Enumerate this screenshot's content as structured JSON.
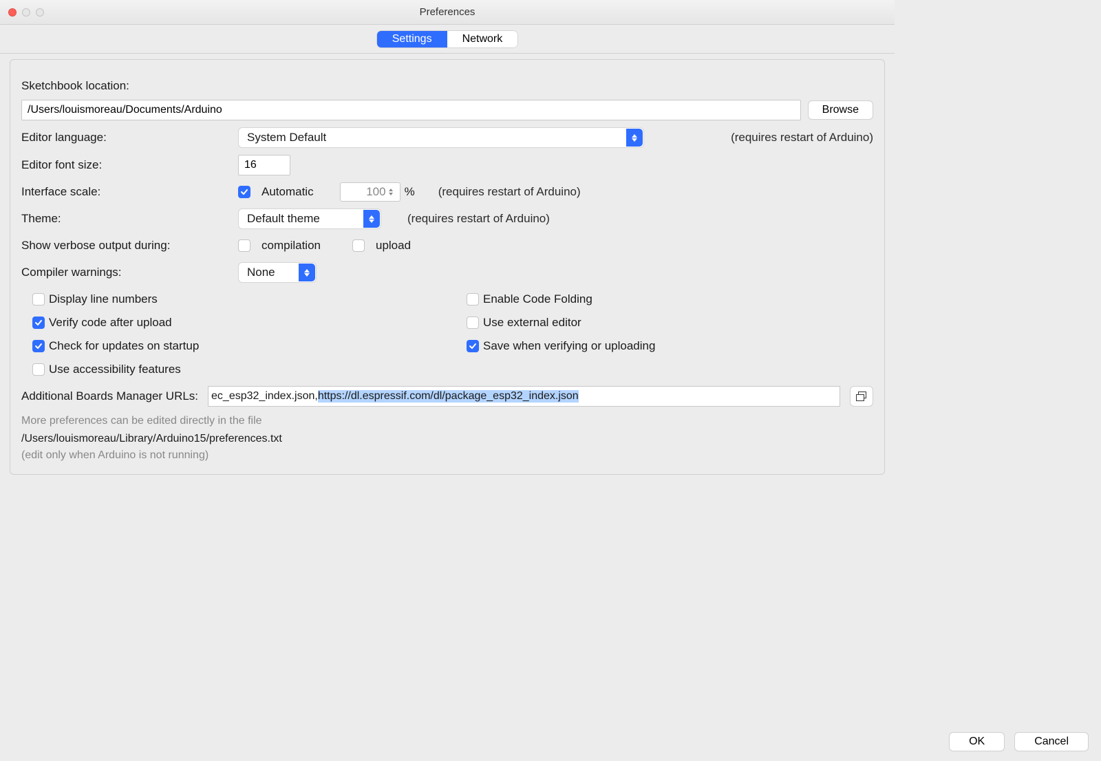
{
  "window": {
    "title": "Preferences"
  },
  "tabs": {
    "settings": "Settings",
    "network": "Network"
  },
  "sketchbook": {
    "label": "Sketchbook location:",
    "path": "/Users/louismoreau/Documents/Arduino",
    "browse": "Browse"
  },
  "editor_language": {
    "label": "Editor language:",
    "value": "System Default",
    "hint": "(requires restart of Arduino)"
  },
  "editor_font_size": {
    "label": "Editor font size:",
    "value": "16"
  },
  "interface_scale": {
    "label": "Interface scale:",
    "automatic_label": "Automatic",
    "value": "100",
    "percent": "%",
    "hint": "(requires restart of Arduino)"
  },
  "theme": {
    "label": "Theme:",
    "value": "Default theme",
    "hint": "(requires restart of Arduino)"
  },
  "verbose": {
    "label": "Show verbose output during:",
    "compilation": "compilation",
    "upload": "upload"
  },
  "compiler_warnings": {
    "label": "Compiler warnings:",
    "value": "None"
  },
  "options": {
    "display_line_numbers": "Display line numbers",
    "enable_code_folding": "Enable Code Folding",
    "verify_after_upload": "Verify code after upload",
    "use_external_editor": "Use external editor",
    "check_updates": "Check for updates on startup",
    "save_when_verifying": "Save when verifying or uploading",
    "use_accessibility": "Use accessibility features"
  },
  "boards_urls": {
    "label": "Additional Boards Manager URLs:",
    "prefix": "ec_esp32_index.json, ",
    "selected": "https://dl.espressif.com/dl/package_esp32_index.json"
  },
  "footer": {
    "note": "More preferences can be edited directly in the file",
    "path": "/Users/louismoreau/Library/Arduino15/preferences.txt",
    "note2": "(edit only when Arduino is not running)"
  },
  "buttons": {
    "ok": "OK",
    "cancel": "Cancel"
  }
}
